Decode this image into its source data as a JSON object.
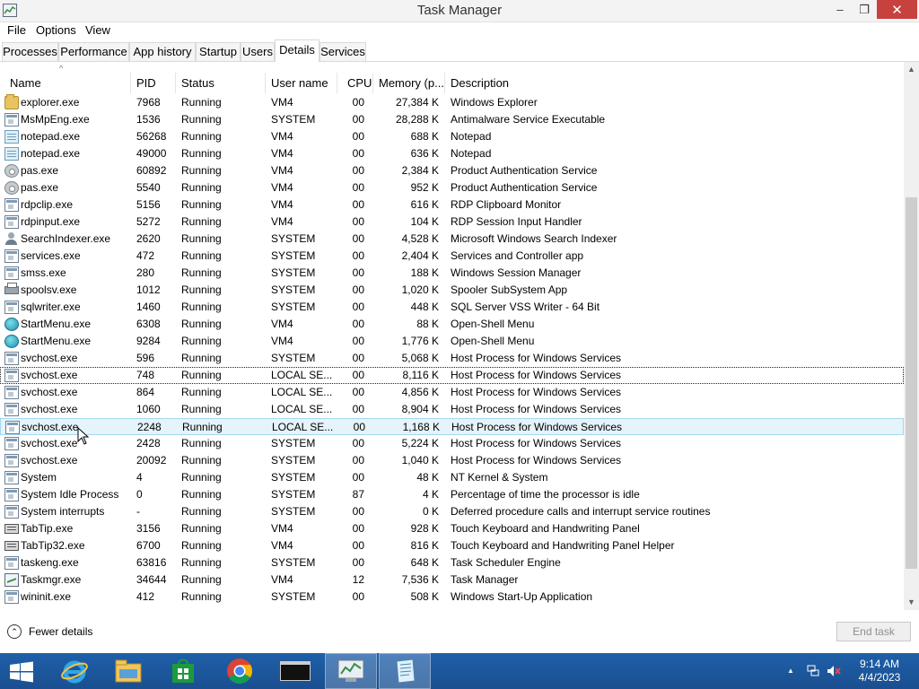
{
  "window": {
    "title": "Task Manager",
    "controls": {
      "minimize": "–",
      "maximize": "❐",
      "close": "✕"
    }
  },
  "menu": [
    "File",
    "Options",
    "View"
  ],
  "tabs": [
    {
      "label": "Processes",
      "active": false
    },
    {
      "label": "Performance",
      "active": false
    },
    {
      "label": "App history",
      "active": false
    },
    {
      "label": "Startup",
      "active": false
    },
    {
      "label": "Users",
      "active": false
    },
    {
      "label": "Details",
      "active": true
    },
    {
      "label": "Services",
      "active": false
    }
  ],
  "columns": {
    "name": "Name",
    "pid": "PID",
    "status": "Status",
    "user": "User name",
    "cpu": "CPU",
    "memory": "Memory (p...",
    "description": "Description"
  },
  "sort_indicator": "^",
  "processes": [
    {
      "icon": "folder-icon",
      "name": "explorer.exe",
      "pid": "7968",
      "status": "Running",
      "user": "VM4",
      "cpu": "00",
      "memory": "27,384 K",
      "description": "Windows Explorer"
    },
    {
      "icon": "window-icon",
      "name": "MsMpEng.exe",
      "pid": "1536",
      "status": "Running",
      "user": "SYSTEM",
      "cpu": "00",
      "memory": "28,288 K",
      "description": "Antimalware Service Executable"
    },
    {
      "icon": "notepad-icon",
      "name": "notepad.exe",
      "pid": "56268",
      "status": "Running",
      "user": "VM4",
      "cpu": "00",
      "memory": "688 K",
      "description": "Notepad"
    },
    {
      "icon": "notepad-icon",
      "name": "notepad.exe",
      "pid": "49000",
      "status": "Running",
      "user": "VM4",
      "cpu": "00",
      "memory": "636 K",
      "description": "Notepad"
    },
    {
      "icon": "disc-icon",
      "name": "pas.exe",
      "pid": "60892",
      "status": "Running",
      "user": "VM4",
      "cpu": "00",
      "memory": "2,384 K",
      "description": "Product Authentication Service"
    },
    {
      "icon": "disc-icon",
      "name": "pas.exe",
      "pid": "5540",
      "status": "Running",
      "user": "VM4",
      "cpu": "00",
      "memory": "952 K",
      "description": "Product Authentication Service"
    },
    {
      "icon": "window-icon",
      "name": "rdpclip.exe",
      "pid": "5156",
      "status": "Running",
      "user": "VM4",
      "cpu": "00",
      "memory": "616 K",
      "description": "RDP Clipboard Monitor"
    },
    {
      "icon": "window-icon",
      "name": "rdpinput.exe",
      "pid": "5272",
      "status": "Running",
      "user": "VM4",
      "cpu": "00",
      "memory": "104 K",
      "description": "RDP Session Input Handler"
    },
    {
      "icon": "person-icon",
      "name": "SearchIndexer.exe",
      "pid": "2620",
      "status": "Running",
      "user": "SYSTEM",
      "cpu": "00",
      "memory": "4,528 K",
      "description": "Microsoft Windows Search Indexer"
    },
    {
      "icon": "window-icon",
      "name": "services.exe",
      "pid": "472",
      "status": "Running",
      "user": "SYSTEM",
      "cpu": "00",
      "memory": "2,404 K",
      "description": "Services and Controller app"
    },
    {
      "icon": "window-icon",
      "name": "smss.exe",
      "pid": "280",
      "status": "Running",
      "user": "SYSTEM",
      "cpu": "00",
      "memory": "188 K",
      "description": "Windows Session Manager"
    },
    {
      "icon": "printer-icon",
      "name": "spoolsv.exe",
      "pid": "1012",
      "status": "Running",
      "user": "SYSTEM",
      "cpu": "00",
      "memory": "1,020 K",
      "description": "Spooler SubSystem App"
    },
    {
      "icon": "window-icon",
      "name": "sqlwriter.exe",
      "pid": "1460",
      "status": "Running",
      "user": "SYSTEM",
      "cpu": "00",
      "memory": "448 K",
      "description": "SQL Server VSS Writer - 64 Bit"
    },
    {
      "icon": "globe-icon",
      "name": "StartMenu.exe",
      "pid": "6308",
      "status": "Running",
      "user": "VM4",
      "cpu": "00",
      "memory": "88 K",
      "description": "Open-Shell Menu"
    },
    {
      "icon": "globe-icon",
      "name": "StartMenu.exe",
      "pid": "9284",
      "status": "Running",
      "user": "VM4",
      "cpu": "00",
      "memory": "1,776 K",
      "description": "Open-Shell Menu"
    },
    {
      "icon": "window-icon",
      "name": "svchost.exe",
      "pid": "596",
      "status": "Running",
      "user": "SYSTEM",
      "cpu": "00",
      "memory": "5,068 K",
      "description": "Host Process for Windows Services"
    },
    {
      "icon": "window-icon",
      "name": "svchost.exe",
      "pid": "748",
      "status": "Running",
      "user": "LOCAL SE...",
      "cpu": "00",
      "memory": "8,116 K",
      "description": "Host Process for Windows Services",
      "focused": true
    },
    {
      "icon": "window-icon",
      "name": "svchost.exe",
      "pid": "864",
      "status": "Running",
      "user": "LOCAL SE...",
      "cpu": "00",
      "memory": "4,856 K",
      "description": "Host Process for Windows Services"
    },
    {
      "icon": "window-icon",
      "name": "svchost.exe",
      "pid": "1060",
      "status": "Running",
      "user": "LOCAL SE...",
      "cpu": "00",
      "memory": "8,904 K",
      "description": "Host Process for Windows Services"
    },
    {
      "icon": "window-icon",
      "name": "svchost.exe",
      "pid": "2248",
      "status": "Running",
      "user": "LOCAL SE...",
      "cpu": "00",
      "memory": "1,168 K",
      "description": "Host Process for Windows Services",
      "selected": true
    },
    {
      "icon": "window-icon",
      "name": "svchost.exe",
      "pid": "2428",
      "status": "Running",
      "user": "SYSTEM",
      "cpu": "00",
      "memory": "5,224 K",
      "description": "Host Process for Windows Services"
    },
    {
      "icon": "window-icon",
      "name": "svchost.exe",
      "pid": "20092",
      "status": "Running",
      "user": "SYSTEM",
      "cpu": "00",
      "memory": "1,040 K",
      "description": "Host Process for Windows Services"
    },
    {
      "icon": "window-icon",
      "name": "System",
      "pid": "4",
      "status": "Running",
      "user": "SYSTEM",
      "cpu": "00",
      "memory": "48 K",
      "description": "NT Kernel & System"
    },
    {
      "icon": "window-icon",
      "name": "System Idle Process",
      "pid": "0",
      "status": "Running",
      "user": "SYSTEM",
      "cpu": "87",
      "memory": "4 K",
      "description": "Percentage of time the processor is idle"
    },
    {
      "icon": "window-icon",
      "name": "System interrupts",
      "pid": "-",
      "status": "Running",
      "user": "SYSTEM",
      "cpu": "00",
      "memory": "0 K",
      "description": "Deferred procedure calls and interrupt service routines"
    },
    {
      "icon": "keyboard-icon",
      "name": "TabTip.exe",
      "pid": "3156",
      "status": "Running",
      "user": "VM4",
      "cpu": "00",
      "memory": "928 K",
      "description": "Touch Keyboard and Handwriting Panel"
    },
    {
      "icon": "keyboard-icon",
      "name": "TabTip32.exe",
      "pid": "6700",
      "status": "Running",
      "user": "VM4",
      "cpu": "00",
      "memory": "816 K",
      "description": "Touch Keyboard and Handwriting Panel Helper"
    },
    {
      "icon": "window-icon",
      "name": "taskeng.exe",
      "pid": "63816",
      "status": "Running",
      "user": "SYSTEM",
      "cpu": "00",
      "memory": "648 K",
      "description": "Task Scheduler Engine"
    },
    {
      "icon": "taskmgr-icon",
      "name": "Taskmgr.exe",
      "pid": "34644",
      "status": "Running",
      "user": "VM4",
      "cpu": "12",
      "memory": "7,536 K",
      "description": "Task Manager"
    },
    {
      "icon": "window-icon",
      "name": "wininit.exe",
      "pid": "412",
      "status": "Running",
      "user": "SYSTEM",
      "cpu": "00",
      "memory": "508 K",
      "description": "Windows Start-Up Application"
    }
  ],
  "footer": {
    "fewer_details": "Fewer details",
    "end_task": "End task"
  },
  "taskbar": {
    "apps": [
      {
        "name": "internet-explorer-icon",
        "active": false
      },
      {
        "name": "file-explorer-icon",
        "active": false
      },
      {
        "name": "store-icon",
        "active": false
      },
      {
        "name": "chrome-icon",
        "active": false
      },
      {
        "name": "terminal-icon",
        "active": false
      },
      {
        "name": "task-manager-icon",
        "active": true
      },
      {
        "name": "notepad-app-icon",
        "active": true
      }
    ],
    "clock_time": "9:14 AM",
    "clock_date": "4/4/2023"
  },
  "colors": {
    "taskbar": "#1f5fa9",
    "selection": "#e5f3fb",
    "close_button": "#c7413f"
  }
}
